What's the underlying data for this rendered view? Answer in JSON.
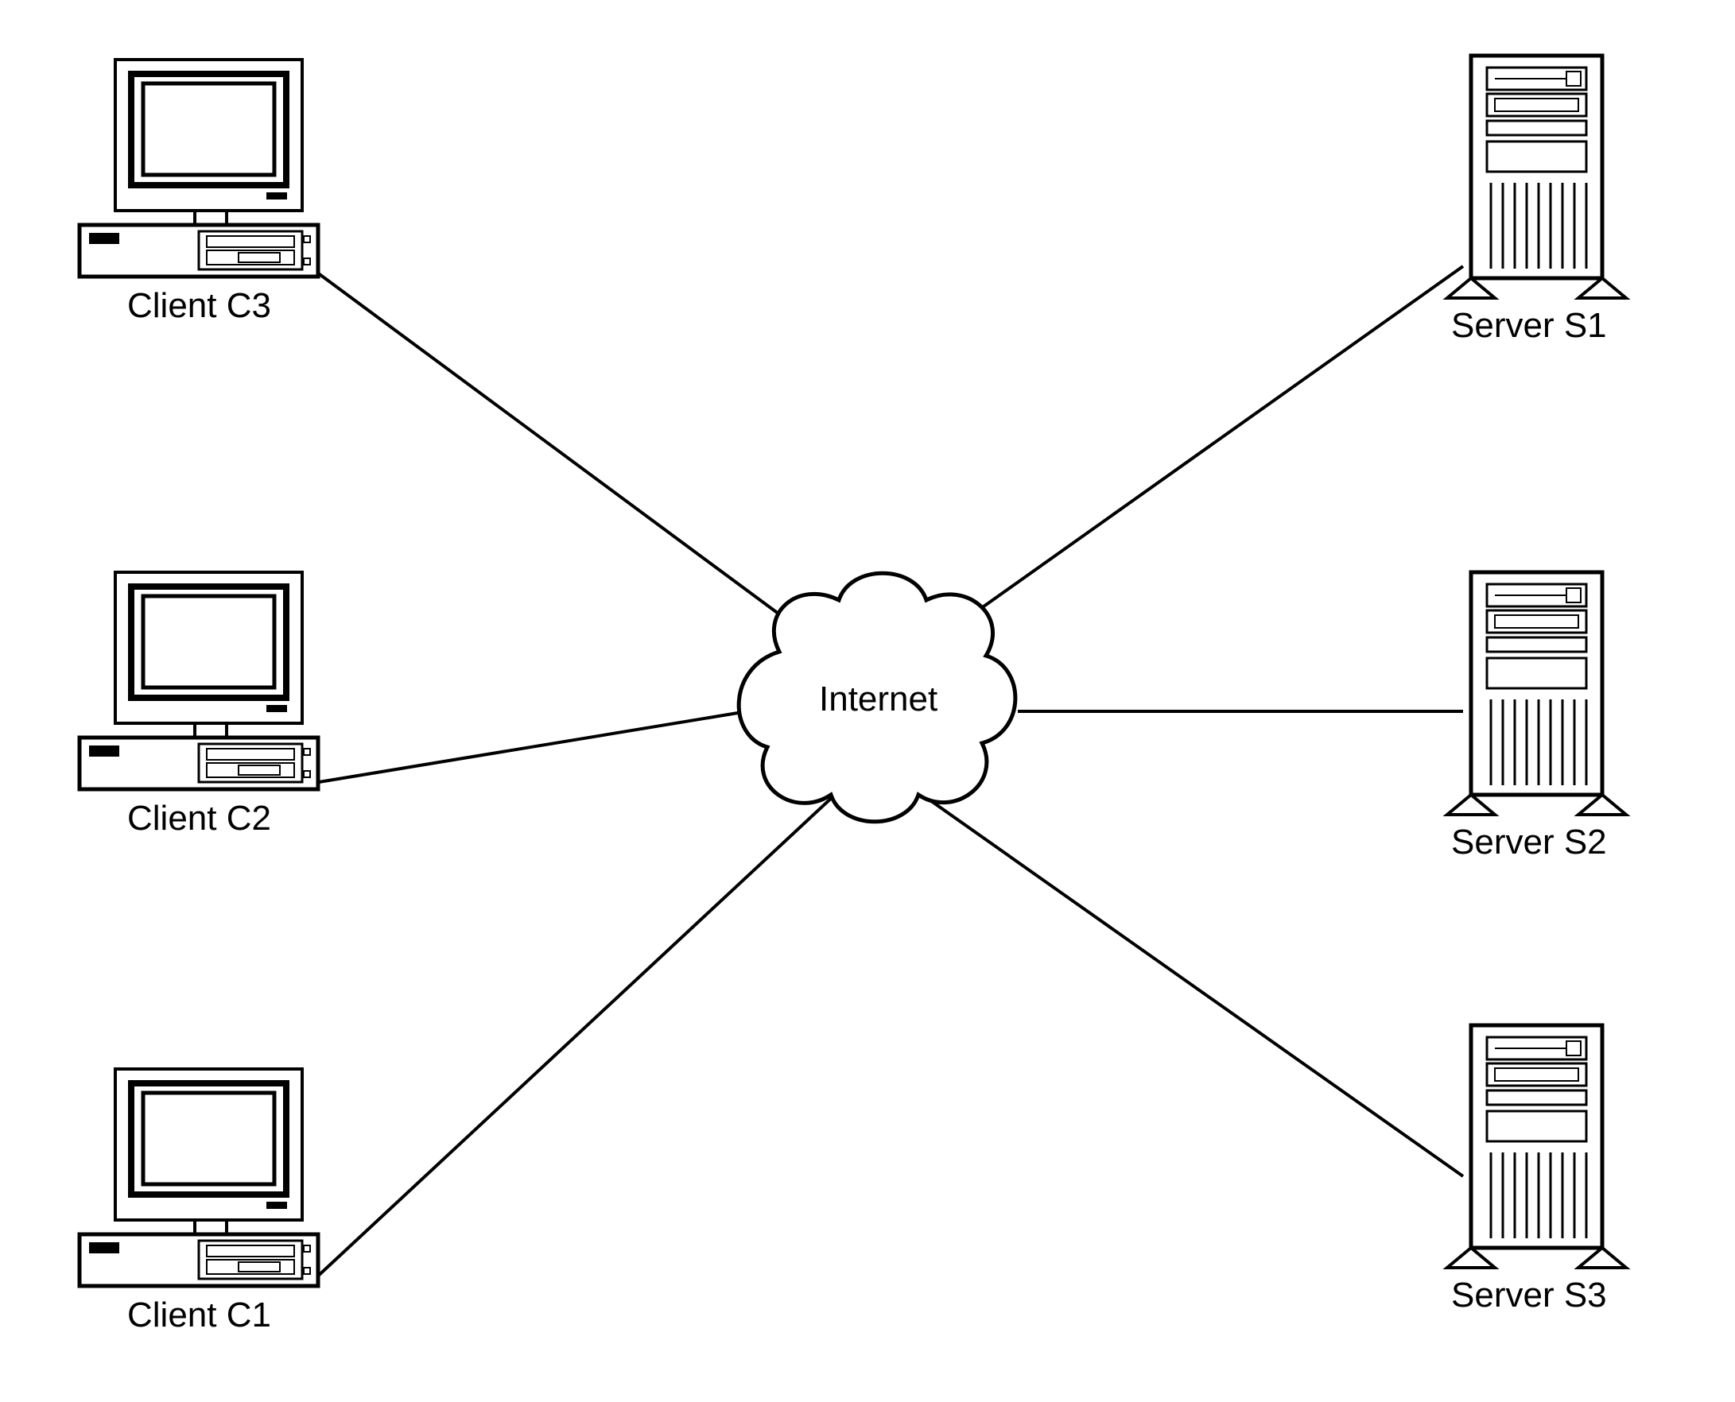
{
  "nodes": {
    "client_c3": {
      "label": "Client C3"
    },
    "client_c2": {
      "label": "Client C2"
    },
    "client_c1": {
      "label": "Client C1"
    },
    "server_s1": {
      "label": "Server S1"
    },
    "server_s2": {
      "label": "Server S2"
    },
    "server_s3": {
      "label": "Server S3"
    },
    "internet": {
      "label": "Internet"
    }
  },
  "diagram": {
    "topology": "star",
    "center": "internet",
    "clients": [
      "client_c1",
      "client_c2",
      "client_c3"
    ],
    "servers": [
      "server_s1",
      "server_s2",
      "server_s3"
    ],
    "edges": [
      [
        "client_c1",
        "internet"
      ],
      [
        "client_c2",
        "internet"
      ],
      [
        "client_c3",
        "internet"
      ],
      [
        "server_s1",
        "internet"
      ],
      [
        "server_s2",
        "internet"
      ],
      [
        "server_s3",
        "internet"
      ]
    ]
  }
}
